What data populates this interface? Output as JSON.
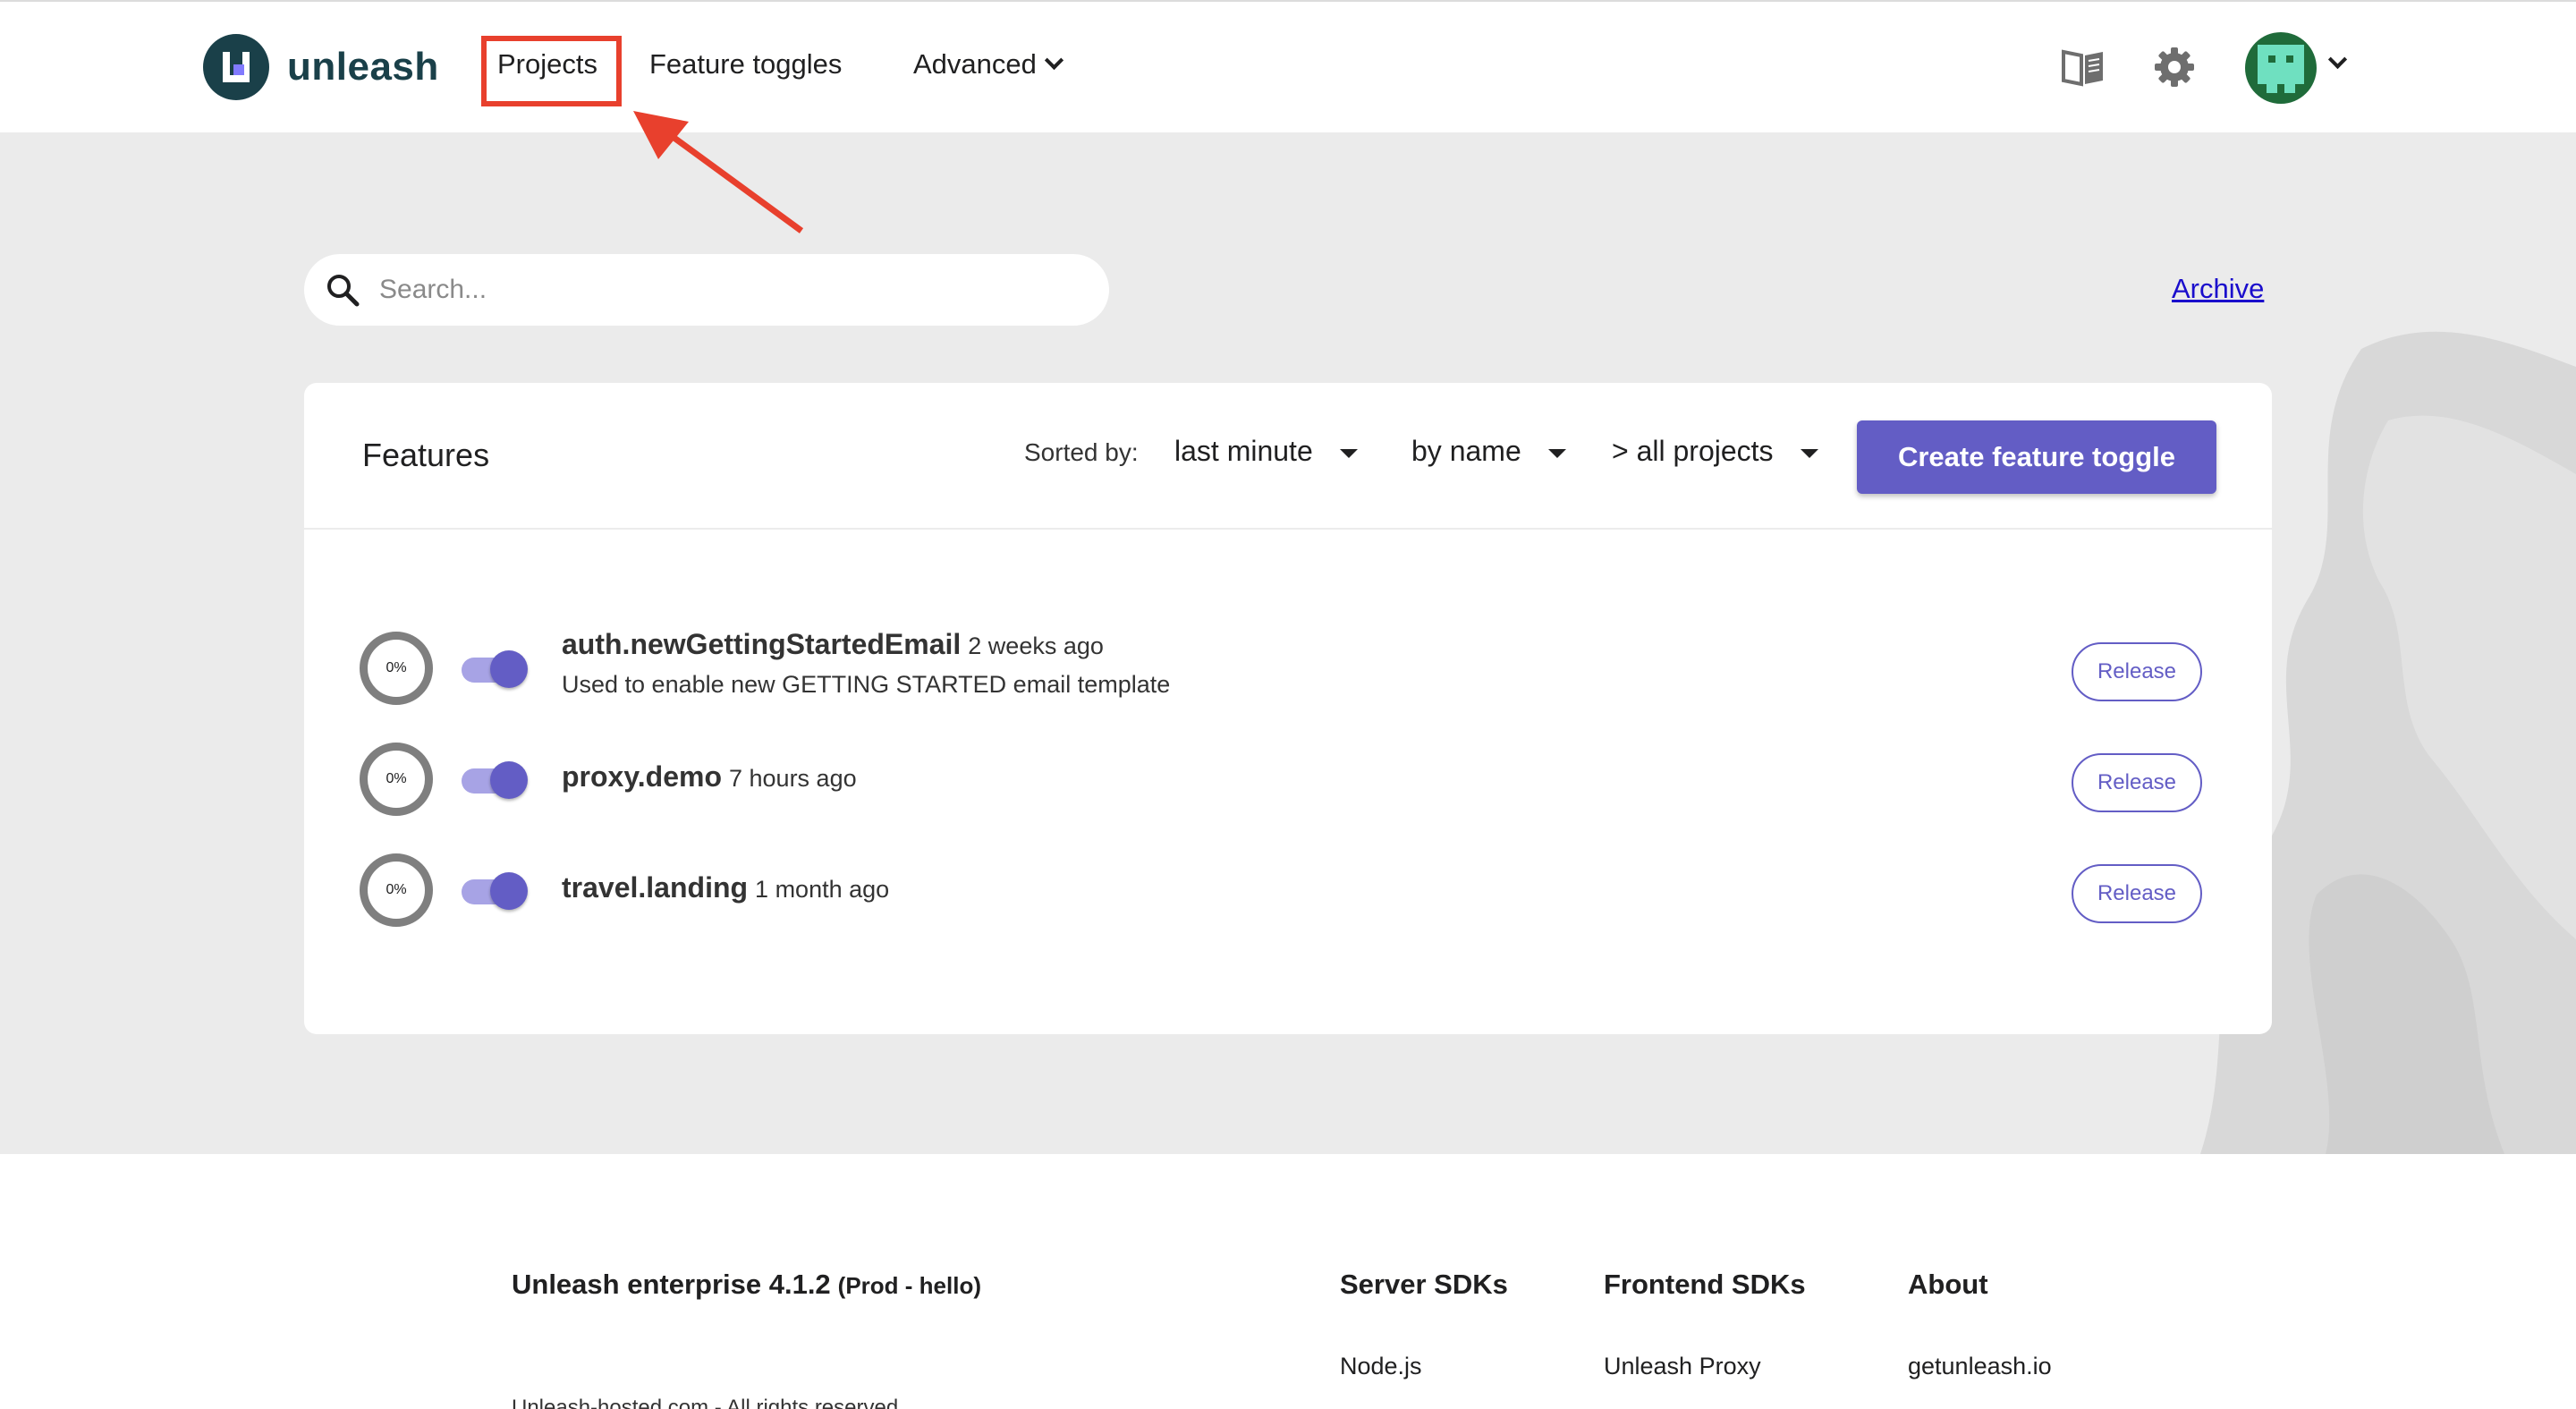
{
  "header": {
    "brand": "unleash",
    "nav": {
      "projects": "Projects",
      "feature_toggles": "Feature toggles",
      "advanced": "Advanced"
    },
    "icons": [
      "book-icon",
      "gear-icon",
      "avatar",
      "chevron-down-icon"
    ]
  },
  "annotation": {
    "highlight_color": "#e8402d"
  },
  "search": {
    "placeholder": "Search...",
    "value": ""
  },
  "archive_link": "Archive",
  "features_card": {
    "title": "Features",
    "sorted_by_label": "Sorted by:",
    "sort_time": "last minute",
    "sort_name": "by name",
    "project_filter": "> all projects",
    "create_button": "Create feature toggle",
    "items": [
      {
        "progress": "0%",
        "enabled": true,
        "name": "auth.newGettingStartedEmail",
        "time": "2 weeks ago",
        "description": "Used to enable new GETTING STARTED email template",
        "type_label": "Release"
      },
      {
        "progress": "0%",
        "enabled": true,
        "name": "proxy.demo",
        "time": "7 hours ago",
        "description": "",
        "type_label": "Release"
      },
      {
        "progress": "0%",
        "enabled": true,
        "name": "travel.landing",
        "time": "1 month ago",
        "description": "",
        "type_label": "Release"
      }
    ]
  },
  "footer": {
    "brand": "Unleash enterprise 4.1.2",
    "env": "(Prod - hello)",
    "copyright": "Unleash-hosted.com - All rights reserved",
    "columns": [
      {
        "title": "Server SDKs",
        "first_link": "Node.js"
      },
      {
        "title": "Frontend SDKs",
        "first_link": "Unleash Proxy"
      },
      {
        "title": "About",
        "first_link": "getunleash.io"
      }
    ]
  },
  "colors": {
    "accent": "#635dc5",
    "brand_dark": "#1a4049",
    "link": "#1a0dcc"
  }
}
